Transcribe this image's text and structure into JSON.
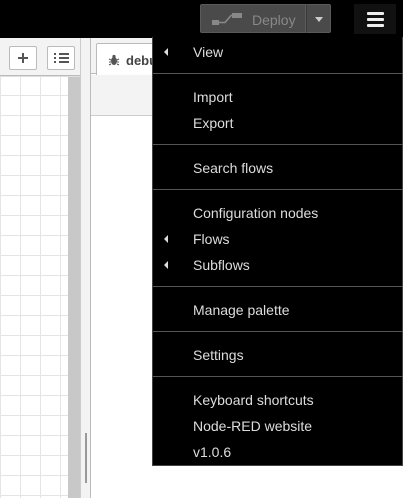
{
  "header": {
    "deploy_label": "Deploy",
    "deploy_icon": "deploy-icon",
    "menu_icon": "hamburger-menu-icon"
  },
  "workspace": {
    "add_flow_icon": "plus-icon",
    "list_flows_icon": "list-icon"
  },
  "sidebar": {
    "tabs": [
      {
        "label": "debu",
        "icon": "bug-icon"
      }
    ]
  },
  "menu": {
    "items": [
      {
        "label": "View",
        "has_submenu": true
      },
      {
        "label": "Import",
        "has_submenu": false
      },
      {
        "label": "Export",
        "has_submenu": false
      },
      {
        "label": "Search flows",
        "has_submenu": false
      },
      {
        "label": "Configuration nodes",
        "has_submenu": false
      },
      {
        "label": "Flows",
        "has_submenu": true
      },
      {
        "label": "Subflows",
        "has_submenu": true
      },
      {
        "label": "Manage palette",
        "has_submenu": false
      },
      {
        "label": "Settings",
        "has_submenu": false
      },
      {
        "label": "Keyboard shortcuts",
        "has_submenu": false
      },
      {
        "label": "Node-RED website",
        "has_submenu": false
      },
      {
        "label": "v1.0.6",
        "has_submenu": false
      }
    ]
  },
  "colors": {
    "header_bg": "#000000",
    "menu_bg": "#000000",
    "menu_text": "#dddddd",
    "deploy_bg": "#4a4a4a",
    "canvas_grid": "#e4e4e4"
  }
}
